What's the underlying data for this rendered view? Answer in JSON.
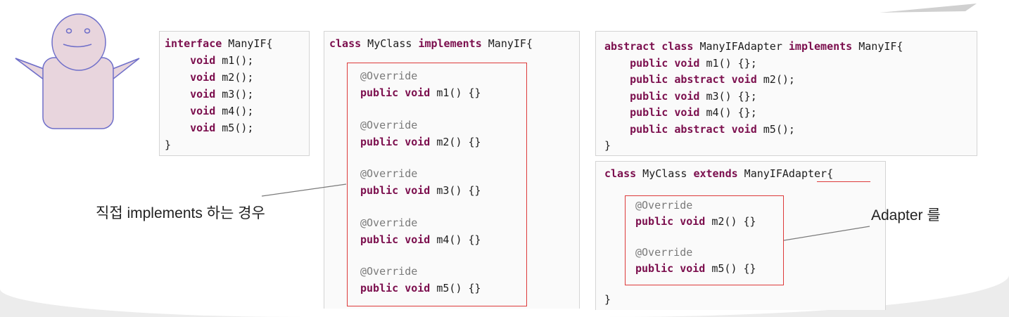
{
  "colors": {
    "keyword": "#7b0e4d",
    "annotation": "#7a7a7a",
    "highlight_box": "#dd3a3a"
  },
  "figure": "smiling-person-shrugging",
  "interface_block": {
    "lines": [
      [
        {
          "t": "interface",
          "k": "kw"
        },
        {
          "t": " ManyIF{"
        }
      ],
      [
        {
          "t": "    "
        },
        {
          "t": "void",
          "k": "kw"
        },
        {
          "t": " m1();"
        }
      ],
      [
        {
          "t": "    "
        },
        {
          "t": "void",
          "k": "kw"
        },
        {
          "t": " m2();"
        }
      ],
      [
        {
          "t": "    "
        },
        {
          "t": "void",
          "k": "kw"
        },
        {
          "t": " m3();"
        }
      ],
      [
        {
          "t": "    "
        },
        {
          "t": "void",
          "k": "kw"
        },
        {
          "t": " m4();"
        }
      ],
      [
        {
          "t": "    "
        },
        {
          "t": "void",
          "k": "kw"
        },
        {
          "t": " m5();"
        }
      ],
      [
        {
          "t": "}"
        }
      ]
    ]
  },
  "myclass_block": {
    "header": [
      {
        "t": "class",
        "k": "kw"
      },
      {
        "t": " MyClass "
      },
      {
        "t": "implements",
        "k": "kw"
      },
      {
        "t": " ManyIF{"
      }
    ],
    "methods": [
      {
        "annotation": "@Override",
        "name": "m1() {}"
      },
      {
        "annotation": "@Override",
        "name": "m2() {}"
      },
      {
        "annotation": "@Override",
        "name": "m3() {}"
      },
      {
        "annotation": "@Override",
        "name": "m4() {}"
      },
      {
        "annotation": "@Override",
        "name": "m5() {}"
      }
    ],
    "method_prefix": "public void"
  },
  "adapter_block": {
    "lines": [
      [
        {
          "t": "abstract",
          "k": "kw"
        },
        {
          "t": " "
        },
        {
          "t": "class",
          "k": "kw"
        },
        {
          "t": " ManyIFAdapter "
        },
        {
          "t": "implements",
          "k": "kw"
        },
        {
          "t": " ManyIF{"
        }
      ],
      [
        {
          "t": "    "
        },
        {
          "t": "public",
          "k": "kw"
        },
        {
          "t": " "
        },
        {
          "t": "void",
          "k": "kw"
        },
        {
          "t": " m1() {};"
        }
      ],
      [
        {
          "t": "    "
        },
        {
          "t": "public",
          "k": "kw"
        },
        {
          "t": " "
        },
        {
          "t": "abstract",
          "k": "kw"
        },
        {
          "t": " "
        },
        {
          "t": "void",
          "k": "kw"
        },
        {
          "t": " m2();"
        }
      ],
      [
        {
          "t": "    "
        },
        {
          "t": "public",
          "k": "kw"
        },
        {
          "t": " "
        },
        {
          "t": "void",
          "k": "kw"
        },
        {
          "t": " m3() {};"
        }
      ],
      [
        {
          "t": "    "
        },
        {
          "t": "public",
          "k": "kw"
        },
        {
          "t": " "
        },
        {
          "t": "void",
          "k": "kw"
        },
        {
          "t": " m4() {};"
        }
      ],
      [
        {
          "t": "    "
        },
        {
          "t": "public",
          "k": "kw"
        },
        {
          "t": " "
        },
        {
          "t": "abstract",
          "k": "kw"
        },
        {
          "t": " "
        },
        {
          "t": "void",
          "k": "kw"
        },
        {
          "t": " m5();"
        }
      ],
      [
        {
          "t": "}"
        }
      ]
    ]
  },
  "extends_block": {
    "header": [
      {
        "t": "class",
        "k": "kw"
      },
      {
        "t": " MyClass "
      },
      {
        "t": "extends",
        "k": "kw"
      },
      {
        "t": " ManyIFAdapter{"
      }
    ],
    "methods": [
      {
        "annotation": "@Override",
        "name": "m2() {}"
      },
      {
        "annotation": "@Override",
        "name": "m5() {}"
      }
    ],
    "method_prefix": "public void",
    "closing": "}"
  },
  "labels": {
    "direct_implements": "직접 implements 하는 경우",
    "adapter": "Adapter 를"
  }
}
